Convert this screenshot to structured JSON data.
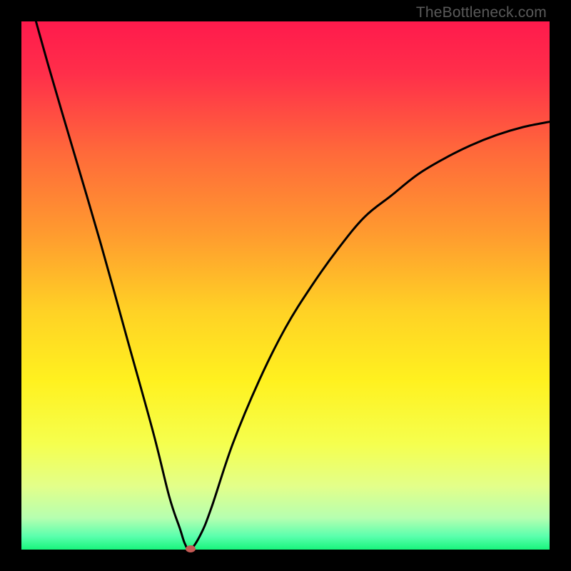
{
  "watermark": "TheBottleneck.com",
  "chart_data": {
    "type": "line",
    "title": "",
    "xlabel": "",
    "ylabel": "",
    "xlim": [
      0,
      100
    ],
    "ylim": [
      0,
      100
    ],
    "series": [
      {
        "name": "bottleneck-curve",
        "x": [
          0,
          5,
          10,
          15,
          20,
          25,
          28,
          30,
          31,
          32,
          34,
          36,
          40,
          45,
          50,
          55,
          60,
          65,
          70,
          75,
          80,
          85,
          90,
          95,
          100
        ],
        "values": [
          110,
          92,
          75,
          58,
          40,
          22,
          10,
          4,
          1,
          0,
          3,
          8,
          20,
          32,
          42,
          50,
          57,
          63,
          67,
          71,
          74,
          76.5,
          78.5,
          80,
          81
        ]
      }
    ],
    "marker": {
      "x": 32,
      "y": 0,
      "color": "#c55a55"
    },
    "gradient_stops": [
      {
        "pos": 0.0,
        "color": "#ff1a4c"
      },
      {
        "pos": 0.1,
        "color": "#ff2f4a"
      },
      {
        "pos": 0.25,
        "color": "#ff6a3a"
      },
      {
        "pos": 0.4,
        "color": "#ff9a2f"
      },
      {
        "pos": 0.55,
        "color": "#ffd225"
      },
      {
        "pos": 0.68,
        "color": "#fff11f"
      },
      {
        "pos": 0.8,
        "color": "#f5ff4e"
      },
      {
        "pos": 0.88,
        "color": "#e3ff8a"
      },
      {
        "pos": 0.94,
        "color": "#b6ffb0"
      },
      {
        "pos": 0.975,
        "color": "#5affad"
      },
      {
        "pos": 1.0,
        "color": "#18f57c"
      }
    ]
  }
}
